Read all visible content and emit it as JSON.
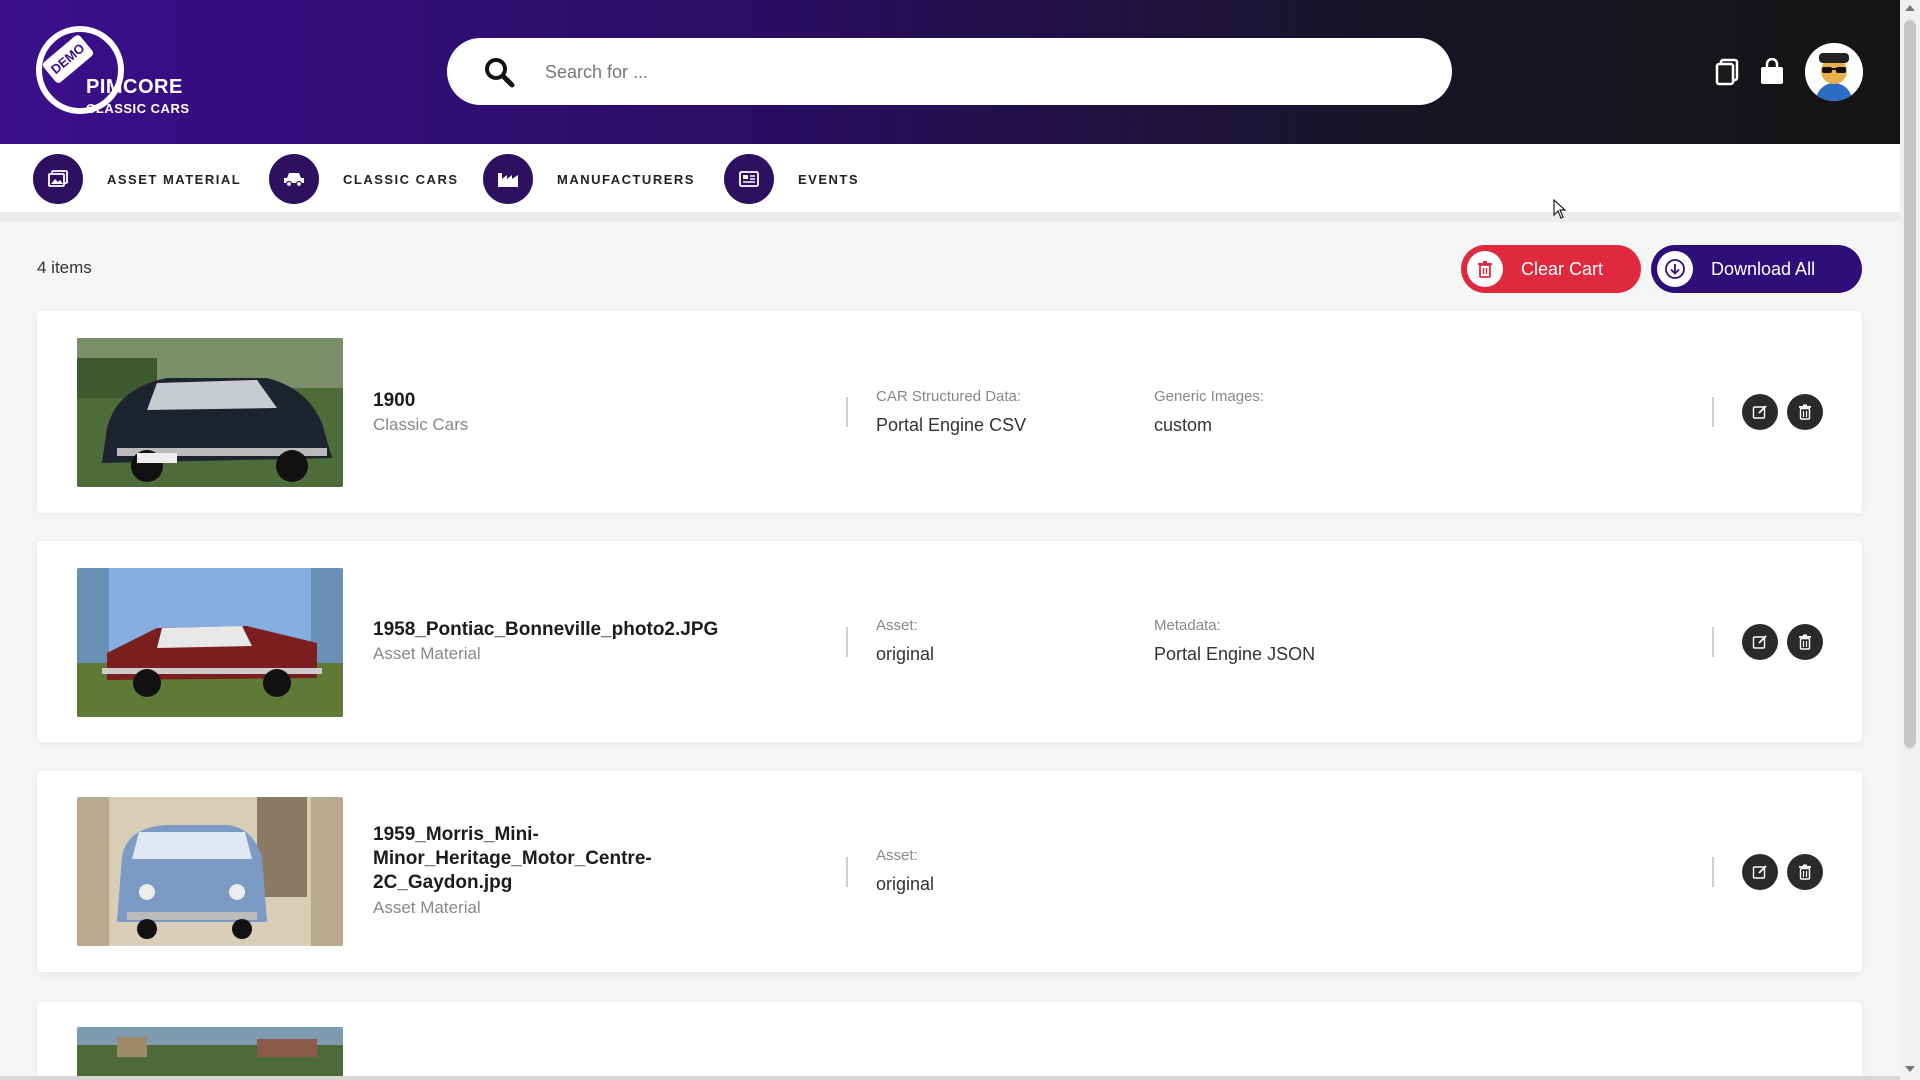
{
  "brand": {
    "badge": "DEMO",
    "name": "PIMCORE",
    "subtitle": "CLASSIC CARS",
    "primary_color": "#3b0f8c"
  },
  "search": {
    "placeholder": "Search for ...",
    "value": ""
  },
  "header_icons": [
    "clipboard-icon",
    "shopping-bag-icon",
    "user-avatar"
  ],
  "nav": {
    "items": [
      {
        "label": "ASSET MATERIAL",
        "icon": "images-icon"
      },
      {
        "label": "CLASSIC CARS",
        "icon": "car-icon"
      },
      {
        "label": "MANUFACTURERS",
        "icon": "factory-icon"
      },
      {
        "label": "EVENTS",
        "icon": "newspaper-icon"
      }
    ]
  },
  "cart": {
    "count_label": "4 items",
    "clear_label": "Clear Cart",
    "download_label": "Download All",
    "clear_color": "#e0283e",
    "download_color": "#2e0f7a",
    "items": [
      {
        "title": "1900",
        "category": "Classic Cars",
        "meta": [
          {
            "label": "CAR Structured Data:",
            "value": "Portal Engine CSV"
          },
          {
            "label": "Generic Images:",
            "value": "custom"
          }
        ]
      },
      {
        "title": "1958_Pontiac_Bonneville_photo2.JPG",
        "category": "Asset Material",
        "meta": [
          {
            "label": "Asset:",
            "value": "original"
          },
          {
            "label": "Metadata:",
            "value": "Portal Engine JSON"
          }
        ]
      },
      {
        "title": "1959_Morris_Mini-Minor_Heritage_Motor_Centre-2C_Gaydon.jpg",
        "title_lines": [
          "1959_Morris_Mini-",
          "Minor_Heritage_Motor_Centre-",
          "2C_Gaydon.jpg"
        ],
        "category": "Asset Material",
        "meta": [
          {
            "label": "Asset:",
            "value": "original"
          }
        ]
      },
      {
        "title": "",
        "category": "",
        "meta": []
      }
    ]
  }
}
